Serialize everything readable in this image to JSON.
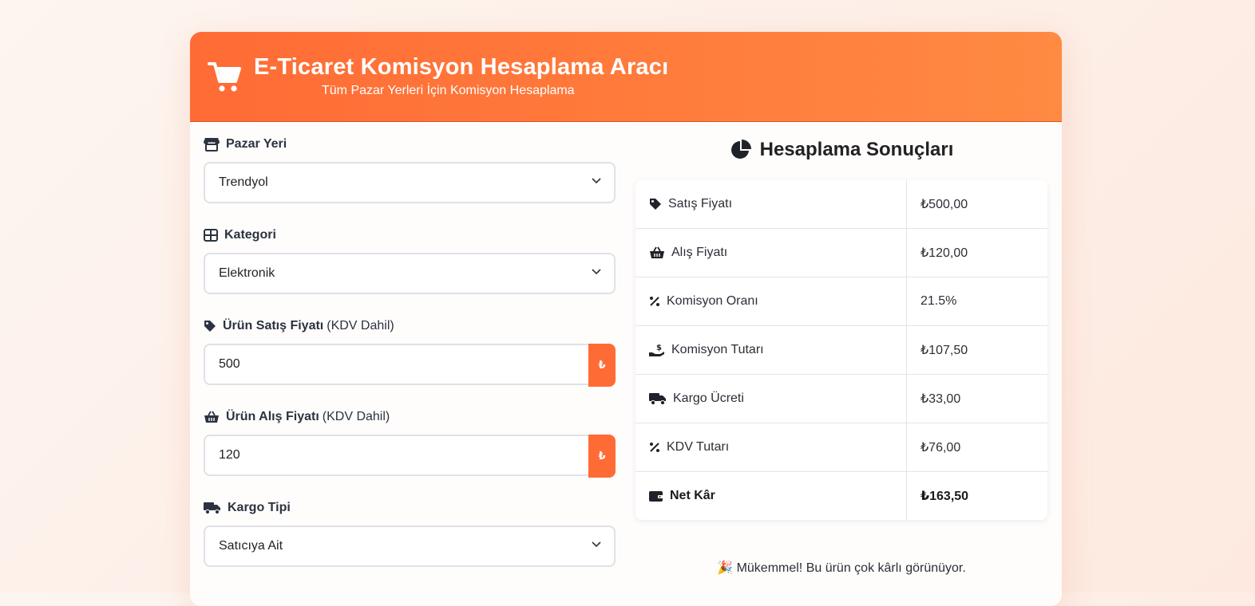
{
  "header": {
    "title": "E-Ticaret Komisyon Hesaplama Aracı",
    "subtitle": "Tüm Pazar Yerleri İçin Komisyon Hesaplama",
    "icon": "shopping-cart-icon"
  },
  "form": {
    "marketplace": {
      "label": "Pazar Yeri",
      "value": "Trendyol",
      "icon": "store-icon"
    },
    "category": {
      "label": "Kategori",
      "value": "Elektronik",
      "icon": "grid-icon"
    },
    "sale_price": {
      "label": "Ürün Satış Fiyatı",
      "label_suffix": "(KDV Dahil)",
      "value": "500",
      "addon": "₺",
      "icon": "tag-icon"
    },
    "purchase_price": {
      "label": "Ürün Alış Fiyatı",
      "label_suffix": "(KDV Dahil)",
      "value": "120",
      "addon": "₺",
      "icon": "basket-icon"
    },
    "shipping": {
      "label": "Kargo Tipi",
      "value": "Satıcıya Ait",
      "icon": "truck-icon"
    }
  },
  "results": {
    "title": "Hesaplama Sonuçları",
    "rows": [
      {
        "label": "Satış Fiyatı",
        "value": "₺500,00",
        "icon": "tag-icon"
      },
      {
        "label": "Alış Fiyatı",
        "value": "₺120,00",
        "icon": "basket-icon"
      },
      {
        "label": "Komisyon Oranı",
        "value": "21.5%",
        "icon": "percent-icon"
      },
      {
        "label": "Komisyon Tutarı",
        "value": "₺107,50",
        "icon": "hand-holding-dollar-icon"
      },
      {
        "label": "Kargo Ücreti",
        "value": "₺33,00",
        "icon": "truck-icon"
      },
      {
        "label": "KDV Tutarı",
        "value": "₺76,00",
        "icon": "percent-icon"
      },
      {
        "label": "Net Kâr",
        "value": "₺163,50",
        "icon": "wallet-icon"
      }
    ],
    "message_emoji": "🎉",
    "message": "Mükemmel! Bu ürün çok kârlı görünüyor."
  },
  "colors": {
    "accent": "#ff6b35",
    "accent_end": "#ff8a42"
  }
}
